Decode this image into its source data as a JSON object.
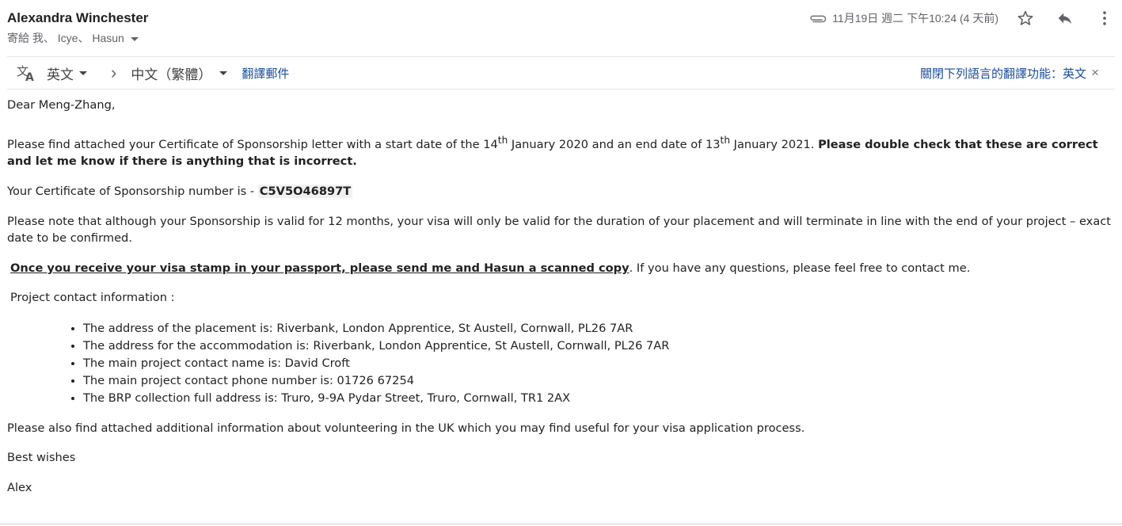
{
  "header": {
    "sender_name": "Alexandra Winchester",
    "recipients_text": "寄給 我、 Icye、 Hasun",
    "date_text": "11月19日 週二 下午10:24 (4 天前)",
    "icons": {
      "attachment": "paperclip-icon",
      "star": "star-icon",
      "reply": "reply-icon",
      "more": "more-vert-icon"
    }
  },
  "translate_bar": {
    "icon": "translate-icon",
    "source_language": "英文",
    "arrow": "›",
    "target_language": "中文（繁體）",
    "translate_link": "翻譯郵件",
    "disable_link": "關閉下列語言的翻譯功能：英文",
    "close_glyph": "×"
  },
  "email": {
    "greeting": "Dear Meng-Zhang,",
    "p1": {
      "t1": "Please find attached your Certificate of Sponsorship letter with a start date of the 14",
      "sup1": "th",
      "t2": " January 2020  and an end date of 13",
      "sup2": "th",
      "t3": " January 2021.  ",
      "bold": "Please double check that these are correct and let me know if there is anything that is incorrect."
    },
    "p2": {
      "label": "Your Certificate of Sponsorship number is - ",
      "number": "C5V5O46897T"
    },
    "p3": "Please note that although your Sponsorship is valid for 12 months, your visa will only be valid for the duration of your placement and will terminate in line with the end of your project – exact date to be confirmed.",
    "p4": {
      "emphasis": "Once you receive your visa stamp in your passport, please send me and Hasun a scanned copy",
      "rest": ". If you have any questions, please feel free to contact me."
    },
    "p5": "Project contact information :",
    "list": [
      "The address of the placement is: Riverbank, London Apprentice, St Austell, Cornwall, PL26 7AR",
      "The address for the accommodation is: Riverbank, London Apprentice, St Austell, Cornwall, PL26 7AR",
      "The main project contact name is: David Croft",
      "The main project contact phone number is: 01726 67254",
      "The BRP collection full address is: Truro, 9-9A Pydar Street, Truro, Cornwall, TR1 2AX"
    ],
    "p6": "Please also find attached additional information about volunteering in the UK which you may find useful for your visa application process.",
    "signoff": "Best wishes",
    "signature": "Alex"
  }
}
